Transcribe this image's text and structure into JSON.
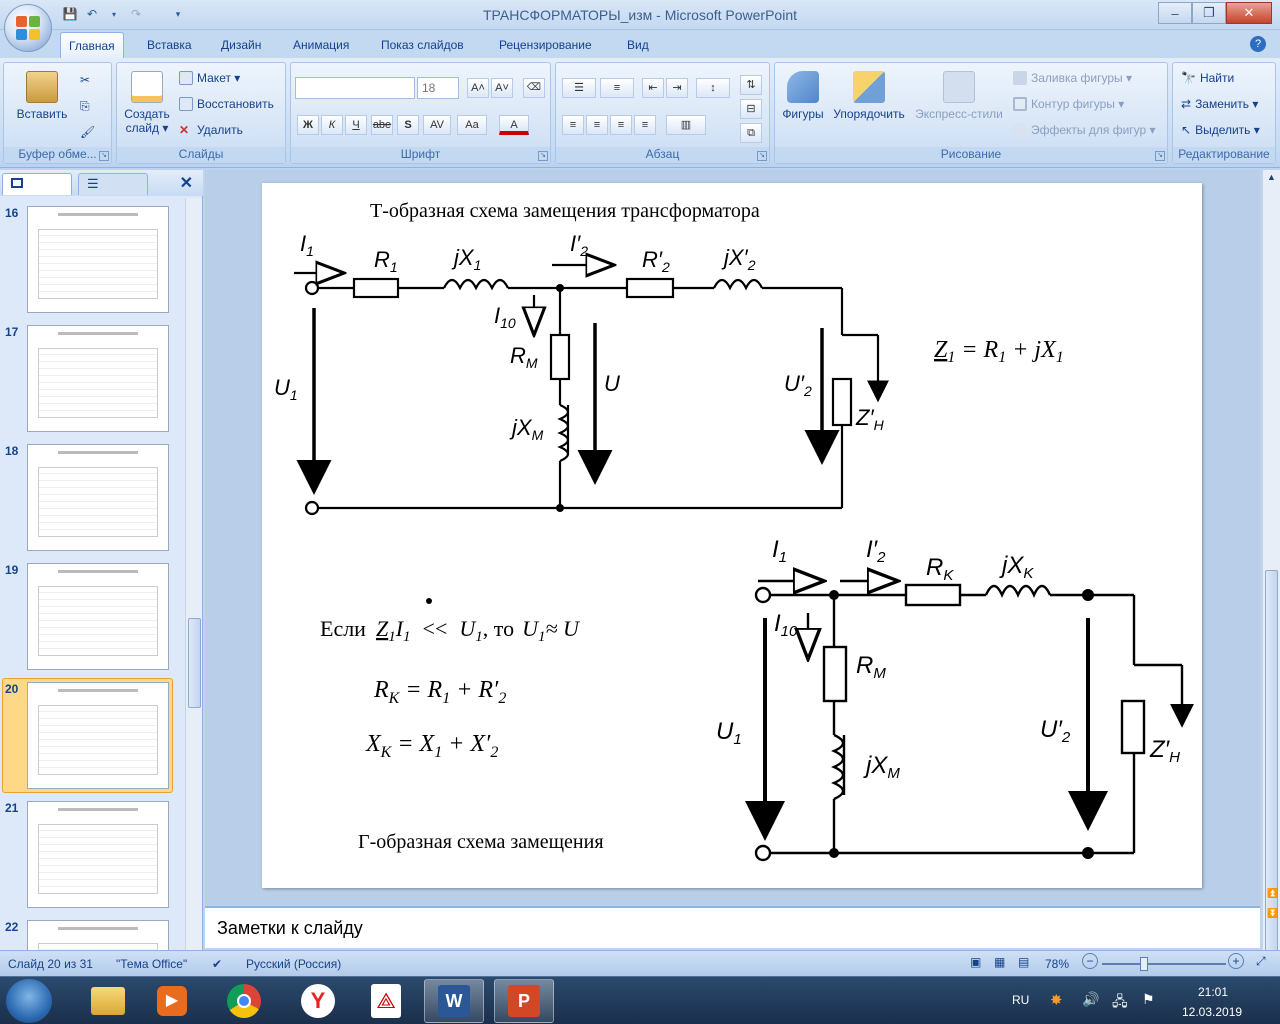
{
  "window": {
    "title": "ТРАНСФОРМАТОРЫ_изм - Microsoft PowerPoint",
    "help_label": "?"
  },
  "ribbon_tabs": [
    "Главная",
    "Вставка",
    "Дизайн",
    "Анимация",
    "Показ слайдов",
    "Рецензирование",
    "Вид"
  ],
  "ribbon": {
    "clipboard": {
      "paste": "Вставить",
      "group": "Буфер обме..."
    },
    "slides": {
      "new_slide_line1": "Создать",
      "new_slide_line2": "слайд ▾",
      "layout": "Макет ▾",
      "reset": "Восстановить",
      "delete": "Удалить",
      "group": "Слайды"
    },
    "font": {
      "size": "18",
      "group": "Шрифт",
      "bold": "Ж",
      "italic": "К",
      "underline": "Ч",
      "strike": "abe",
      "shadow": "S",
      "spacing": "AV",
      "case": "Aa",
      "color": "A",
      "grow": "A˄",
      "shrink": "A˅"
    },
    "paragraph": {
      "group": "Абзац"
    },
    "drawing": {
      "shapes": "Фигуры",
      "arrange": "Упорядочить",
      "styles": "Экспресс-стили",
      "fill": "Заливка фигуры ▾",
      "outline": "Контур фигуры ▾",
      "effects": "Эффекты для фигур ▾",
      "group": "Рисование"
    },
    "editing": {
      "find": "Найти",
      "replace": "Заменить ▾",
      "select": "Выделить ▾",
      "group": "Редактирование"
    }
  },
  "thumbnails": [
    {
      "num": "16",
      "selected": false
    },
    {
      "num": "17",
      "selected": false
    },
    {
      "num": "18",
      "selected": false
    },
    {
      "num": "19",
      "selected": false
    },
    {
      "num": "20",
      "selected": true
    },
    {
      "num": "21",
      "selected": false
    },
    {
      "num": "22",
      "selected": false
    }
  ],
  "slide": {
    "title_t": "Т-образная схема замещения трансформатора",
    "title_g": "Г-образная схема замещения",
    "formula_z1": {
      "lhs": "Z",
      "lhs_sub": "1",
      "eq": " = R",
      "r_sub": "1",
      "plus": " + jX",
      "x_sub": "1"
    },
    "condition": {
      "if": "Если",
      "z": "Z",
      "z_sub": "1",
      "i": "I",
      "i_sub": "1",
      "lt": "<<",
      "u": "U",
      "u_sub": "1",
      "then": ", то",
      "u2": "U",
      "u2_sub": "1",
      "approx": "≈ U"
    },
    "rk": {
      "r": "R",
      "k": "K",
      "eq": " = R",
      "s1": "1",
      "plus": " + R′",
      "s2": "2"
    },
    "xk": {
      "x": "X",
      "k": "K",
      "eq": " = X",
      "s1": "1",
      "plus": " + X′",
      "s2": "2"
    },
    "circuit_t": {
      "i1": "I",
      "i1s": "1",
      "r1": "R",
      "r1s": "1",
      "jx1": "jX",
      "jx1s": "1",
      "i2": "I′",
      "i2s": "2",
      "r2": "R′",
      "r2s": "2",
      "jx2": "jX′",
      "jx2s": "2",
      "i10": "I",
      "i10s": "10",
      "rm": "R",
      "rms": "M",
      "jxm": "jX",
      "jxms": "M",
      "u": "U",
      "u1": "U",
      "u1s": "1",
      "u2": "U′",
      "u2s": "2",
      "zh": "Z′",
      "zhs": "H"
    },
    "circuit_g": {
      "i1": "I",
      "i1s": "1",
      "i2": "I′",
      "i2s": "2",
      "rk": "R",
      "rks": "K",
      "jxk": "jX",
      "jxks": "K",
      "i10": "I",
      "i10s": "10",
      "rm": "R",
      "rms": "M",
      "jxm": "jX",
      "jxms": "M",
      "u1": "U",
      "u1s": "1",
      "u2": "U′",
      "u2s": "2",
      "zh": "Z′",
      "zhs": "H"
    }
  },
  "notes": {
    "placeholder": "Заметки к слайду"
  },
  "status": {
    "slide": "Слайд 20 из 31",
    "theme": "\"Тема Office\"",
    "lang": "Русский (Россия)",
    "zoom": "78%"
  },
  "taskbar": {
    "lang": "RU",
    "time": "21:01",
    "date": "12.03.2019"
  }
}
